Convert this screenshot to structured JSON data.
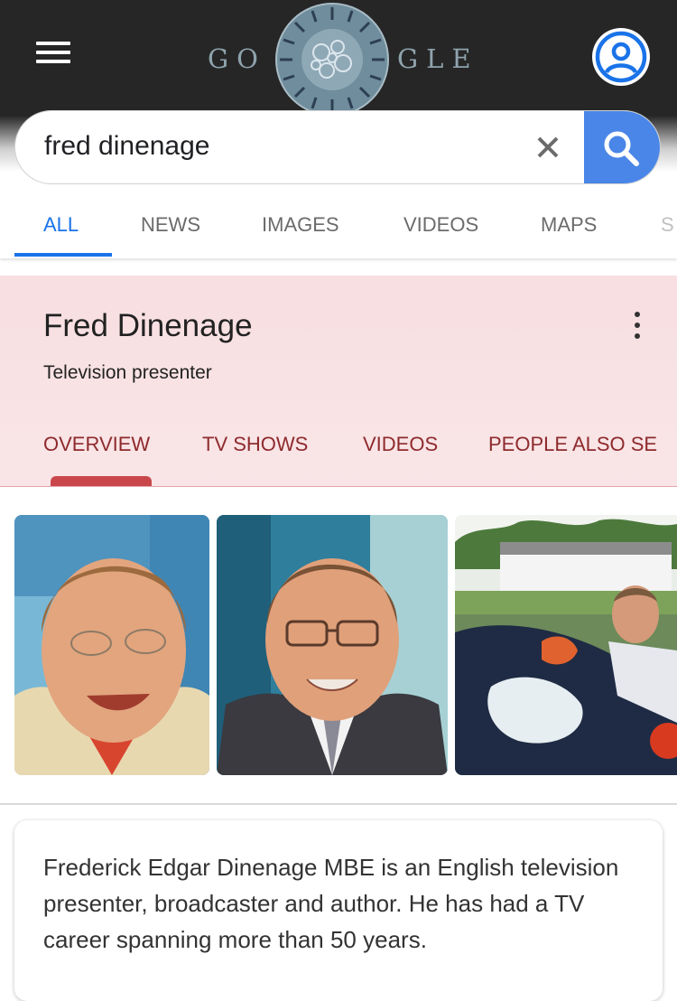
{
  "header": {
    "menu_icon": "hamburger-menu-icon",
    "logo": {
      "left": "GO",
      "right": "GLE"
    },
    "doodle_icon": "google-doodle-icon",
    "account_icon": "account-circle-icon"
  },
  "search": {
    "query": "fred dinenage",
    "clear_icon": "close-icon",
    "search_icon": "search-icon",
    "accent": "#4a86e8"
  },
  "tabs": [
    "ALL",
    "NEWS",
    "IMAGES",
    "VIDEOS",
    "MAPS",
    "S"
  ],
  "active_tab": "ALL",
  "knowledge_panel": {
    "title": "Fred Dinenage",
    "subtitle": "Television presenter",
    "more_icon": "more-vert-icon",
    "tabs": [
      "OVERVIEW",
      "TV SHOWS",
      "VIDEOS",
      "PEOPLE ALSO SE"
    ],
    "active_tab": "OVERVIEW",
    "accent": "#c9474b"
  },
  "images": [
    "fred-dinenage-portrait-1",
    "fred-dinenage-portrait-2",
    "fred-dinenage-washing-car"
  ],
  "description": "Frederick Edgar Dinenage MBE is an English television presenter, broadcaster and author. He has had a TV career spanning more than 50 years."
}
